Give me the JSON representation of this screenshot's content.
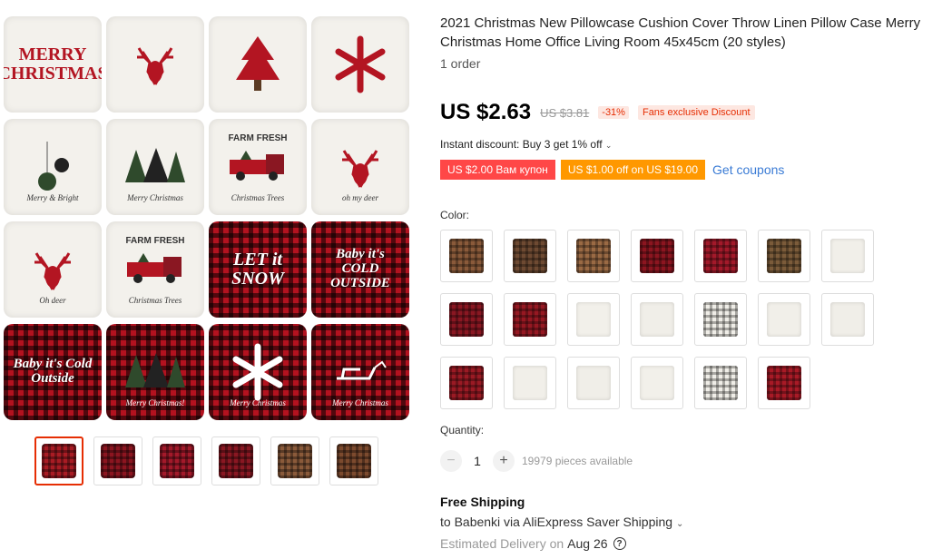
{
  "main_image": {
    "pillows": [
      {
        "style": "cream",
        "text": "MERRY CHRISTMAS",
        "icon": "text"
      },
      {
        "style": "cream",
        "text": "",
        "icon": "deer-head-icon"
      },
      {
        "style": "cream",
        "text": "",
        "icon": "christmas-tree-icon"
      },
      {
        "style": "cream",
        "text": "",
        "icon": "snowflake-icon"
      },
      {
        "style": "cream",
        "text": "Merry & Bright",
        "icon": "ornaments-icon"
      },
      {
        "style": "cream",
        "text": "Merry Christmas",
        "icon": "trees-icon"
      },
      {
        "style": "cream",
        "text": "FARM FRESH",
        "sub": "Christmas Trees",
        "icon": "truck-icon"
      },
      {
        "style": "cream",
        "text": "oh my deer",
        "icon": "deer-head-icon"
      },
      {
        "style": "cream",
        "text": "Oh deer",
        "icon": "deer-head-icon"
      },
      {
        "style": "cream",
        "text": "FARM FRESH",
        "sub": "Christmas Trees",
        "icon": "truck-icon"
      },
      {
        "style": "plaid",
        "text": "LET it SNOW",
        "icon": "text"
      },
      {
        "style": "plaid",
        "text": "Baby it's COLD OUTSIDE",
        "icon": "text"
      },
      {
        "style": "plaid",
        "text": "Baby it's Cold Outside",
        "icon": "text"
      },
      {
        "style": "plaid",
        "text": "Merry Christmas!",
        "icon": "trees-icon"
      },
      {
        "style": "plaid",
        "text": "Merry Christmas",
        "icon": "snowflake-icon"
      },
      {
        "style": "plaid",
        "text": "Merry Christmas",
        "icon": "sleigh-icon"
      }
    ]
  },
  "thumbnails": [
    {
      "label": "collage",
      "color": "#a91c24",
      "active": true
    },
    {
      "label": "plaid-let-it-snow",
      "color": "#8c1520",
      "active": false
    },
    {
      "label": "plaid-snowflakes",
      "color": "#a3192a",
      "active": false
    },
    {
      "label": "plaid-trees",
      "color": "#8a1722",
      "active": false
    },
    {
      "label": "burlap-truck",
      "color": "#8a5a3a",
      "active": false
    },
    {
      "label": "burlap-reindeer",
      "color": "#7c4a2e",
      "active": false
    }
  ],
  "product": {
    "title": "2021 Christmas New Pillowcase Cushion Cover Throw Linen Pillow Case Merry Christmas Home Office Living Room 45x45cm (20 styles)",
    "orders": "1 order",
    "price": "US $2.63",
    "old_price": "US $3.81",
    "discount": "-31%",
    "fans_badge": "Fans exclusive Discount",
    "instant_discount": "Instant discount: Buy 3 get 1% off",
    "coupon_1": "US $2.00 Вам купон",
    "coupon_2": "US $1.00 off on US $19.00",
    "get_coupons": "Get coupons"
  },
  "color": {
    "label": "Color:",
    "swatches": [
      {
        "color": "#8a5a3a"
      },
      {
        "color": "#6e4a32"
      },
      {
        "color": "#9a6a44"
      },
      {
        "color": "#8c1520"
      },
      {
        "color": "#a3192a"
      },
      {
        "color": "#7b5b3a"
      },
      {
        "color": "#f1efe9"
      },
      {
        "color": "#8a1722"
      },
      {
        "color": "#961822"
      },
      {
        "color": "#f2f0ea"
      },
      {
        "color": "#f0eee8"
      },
      {
        "color": "#efede7"
      },
      {
        "color": "#f1efe9"
      },
      {
        "color": "#f0eee8"
      },
      {
        "color": "#9a1a24"
      },
      {
        "color": "#f1efe9"
      },
      {
        "color": "#f0eee8"
      },
      {
        "color": "#f2f0ea"
      },
      {
        "color": "#efede7"
      },
      {
        "color": "#a81a26"
      }
    ]
  },
  "quantity": {
    "label": "Quantity:",
    "value": "1",
    "minus": "−",
    "plus": "+",
    "available": "19979 pieces available"
  },
  "shipping": {
    "title": "Free Shipping",
    "to": "to Babenki via AliExpress Saver Shipping",
    "delivery_prefix": "Estimated Delivery on",
    "delivery_date": "Aug 26",
    "help": "?"
  }
}
